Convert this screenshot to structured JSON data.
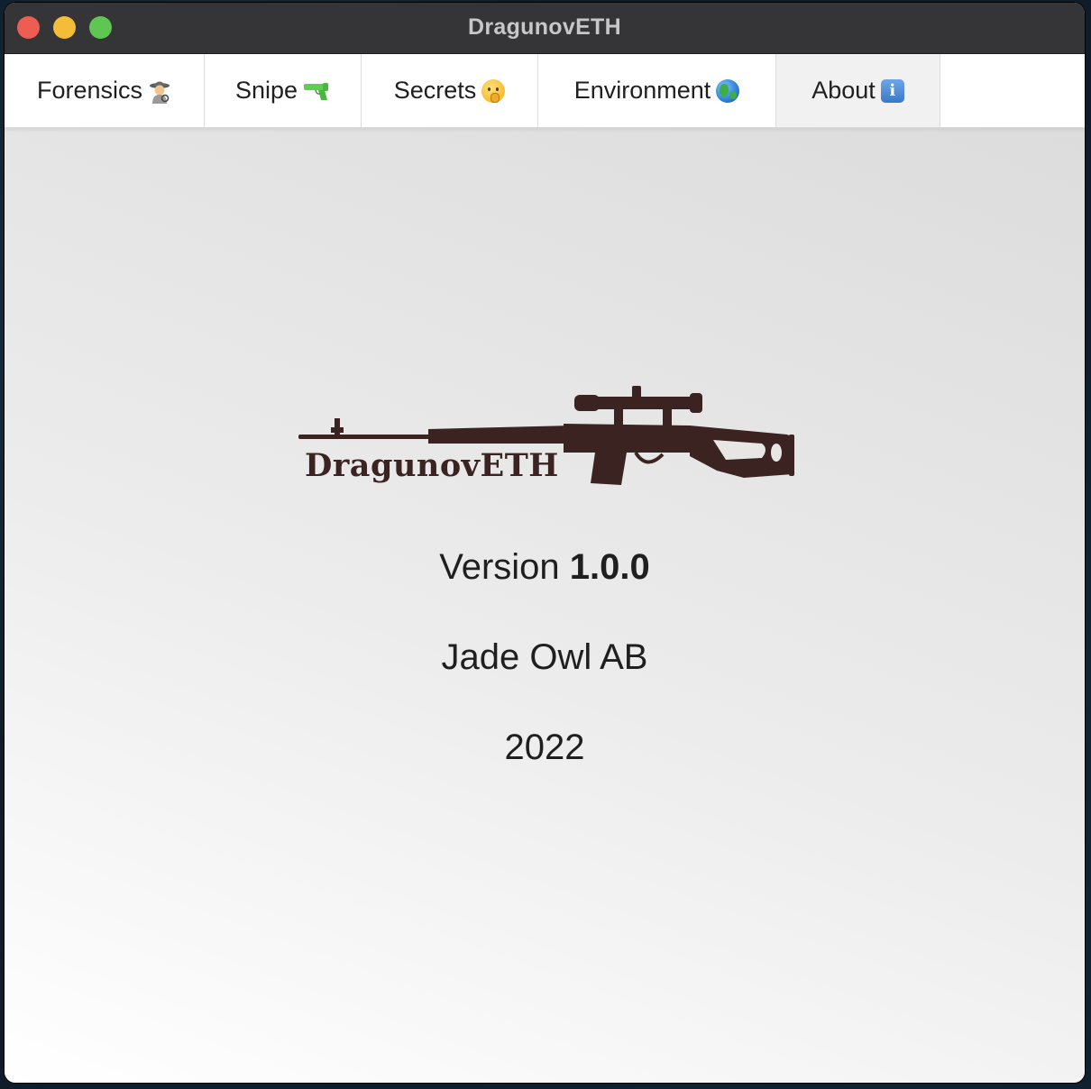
{
  "window": {
    "title": "DragunovETH"
  },
  "tabs": [
    {
      "label": "Forensics",
      "icon": "detective-icon",
      "active": false
    },
    {
      "label": "Snipe",
      "icon": "water-pistol-icon",
      "active": false
    },
    {
      "label": "Secrets",
      "icon": "shushing-face-icon",
      "active": false
    },
    {
      "label": "Environment",
      "icon": "globe-icon",
      "active": false
    },
    {
      "label": "About",
      "icon": "information-icon",
      "active": true
    }
  ],
  "about": {
    "logo_text": "DragunovETH",
    "version_prefix": "Version",
    "version_number": "1.0.0",
    "company": "Jade Owl AB",
    "year": "2022"
  },
  "colors": {
    "titlebar": "#353538",
    "close": "#ee5d52",
    "minimize": "#f4bd38",
    "maximize": "#5fc653",
    "logo": "#3b2321",
    "active_tab": "#f1f1f1"
  }
}
